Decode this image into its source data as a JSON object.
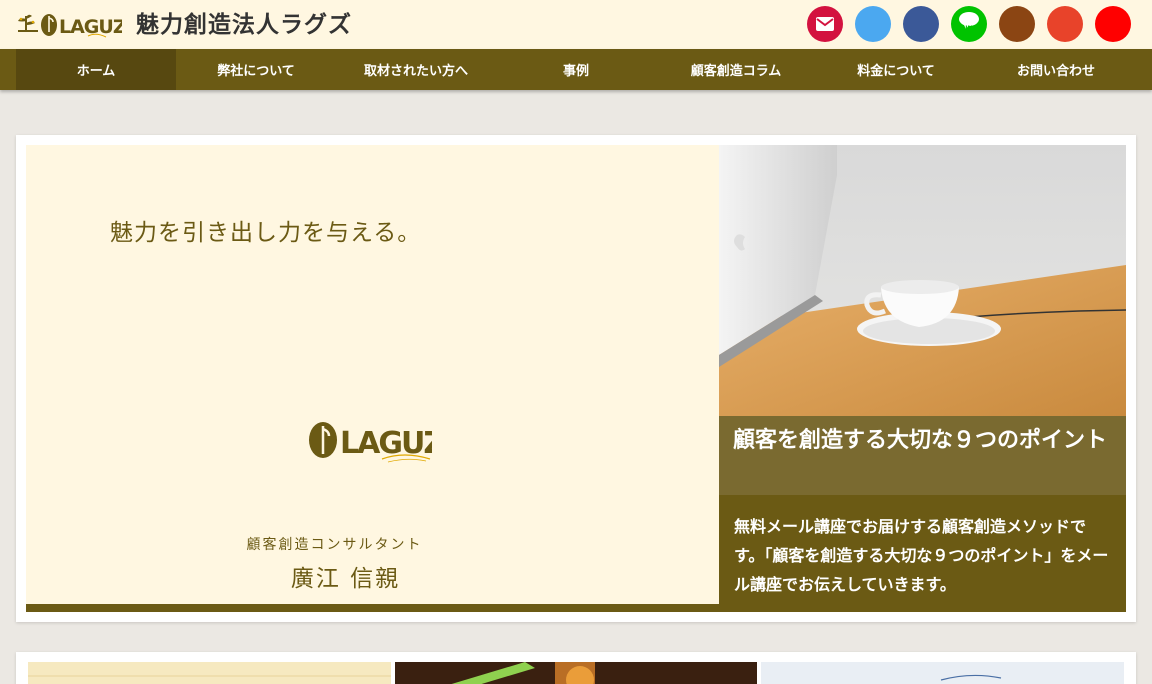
{
  "header": {
    "brand_logo_text": "LAGUZ",
    "site_title": "魅力創造法人ラグズ",
    "social": [
      {
        "name": "mail-icon",
        "color": "#d3123f"
      },
      {
        "name": "twitter-icon",
        "color": "#4ba8f0"
      },
      {
        "name": "facebook-icon",
        "color": "#3b5998"
      },
      {
        "name": "line-icon",
        "color": "#00c300",
        "label": "LINE"
      },
      {
        "name": "blog-icon",
        "color": "#8b4513"
      },
      {
        "name": "google-plus-icon",
        "color": "#e8432a"
      },
      {
        "name": "youtube-icon",
        "color": "#ff0000"
      }
    ]
  },
  "nav": {
    "items": [
      {
        "label": "ホーム",
        "active": true
      },
      {
        "label": "弊社について"
      },
      {
        "label": "取材されたい方へ"
      },
      {
        "label": "事例"
      },
      {
        "label": "顧客創造コラム"
      },
      {
        "label": "料金について"
      },
      {
        "label": "お問い合わせ"
      }
    ]
  },
  "hero": {
    "tagline": "魅力を引き出し力を与える。",
    "logo_text": "LAGUZ",
    "role": "顧客創造コンサルタント",
    "name": "廣江 信親",
    "caption_title": "顧客を創造する大切な９つのポイント",
    "caption_text": "無料メール講座でお届けする顧客創造メソッドです。「顧客を創造する大切な９つのポイント」をメール講座でお伝えしていきます。"
  },
  "colors": {
    "brand": "#6b5a14",
    "brand_dark": "#574810",
    "cream": "#fff7e1",
    "background": "#ebe8e3"
  }
}
